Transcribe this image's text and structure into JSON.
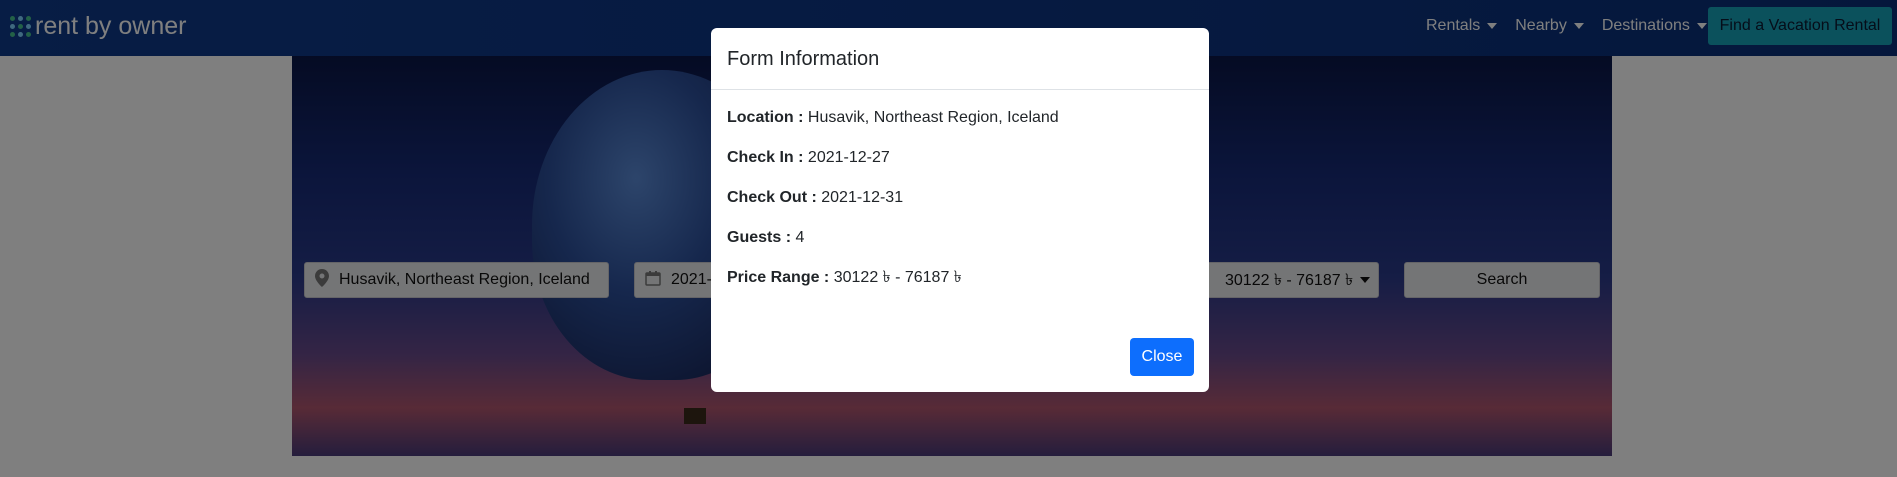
{
  "navbar": {
    "logo_text": "rent by owner",
    "links": [
      {
        "label": "Rentals"
      },
      {
        "label": "Nearby"
      },
      {
        "label": "Destinations"
      }
    ],
    "cta_label": "Find a Vacation Rental"
  },
  "search": {
    "location_value": "Husavik, Northeast Region, Iceland",
    "date_value": "2021-",
    "price_value": "30122 ৳ - 76187 ৳",
    "search_label": "Search"
  },
  "modal": {
    "title": "Form Information",
    "rows": [
      {
        "label": "Location :",
        "value": "Husavik, Northeast Region, Iceland"
      },
      {
        "label": "Check In :",
        "value": "2021-12-27"
      },
      {
        "label": "Check Out :",
        "value": "2021-12-31"
      },
      {
        "label": "Guests :",
        "value": "4"
      },
      {
        "label": "Price Range :",
        "value": "30122 ৳ - 76187 ৳"
      }
    ],
    "close_label": "Close"
  },
  "icons": {
    "location": "location-pin-icon",
    "calendar": "calendar-icon"
  },
  "colors": {
    "navbar": "#0f3a8a",
    "cta": "#17a2b8",
    "primary": "#0d6efd"
  }
}
